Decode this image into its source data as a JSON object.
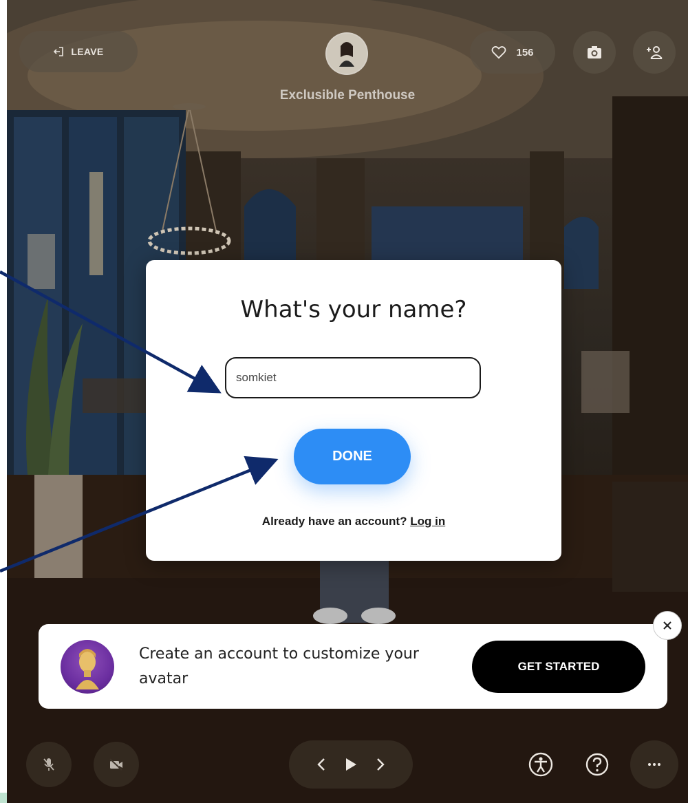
{
  "room": {
    "title": "Exclusible Penthouse"
  },
  "topbar": {
    "leave_label": "LEAVE",
    "like_count": "156"
  },
  "modal": {
    "title": "What's your name?",
    "name_value": "somkiet",
    "done_label": "DONE",
    "login_prompt": "Already have an account?",
    "login_link": "Log in"
  },
  "promo": {
    "text": "Create an account to customize your avatar",
    "cta_label": "GET STARTED"
  },
  "icons": {
    "leave": "exit-icon",
    "like": "heart-icon",
    "camera": "camera-icon",
    "invite": "add-person-icon",
    "mic": "mic-off-icon",
    "video": "video-off-icon",
    "prev": "chevron-left-icon",
    "play": "play-icon",
    "next": "chevron-right-icon",
    "accessibility": "accessibility-icon",
    "help": "help-icon",
    "more": "more-icon",
    "close": "close-icon"
  },
  "colors": {
    "primary": "#2d8df5",
    "cta": "#000000",
    "arrow": "#0f2a6b"
  }
}
